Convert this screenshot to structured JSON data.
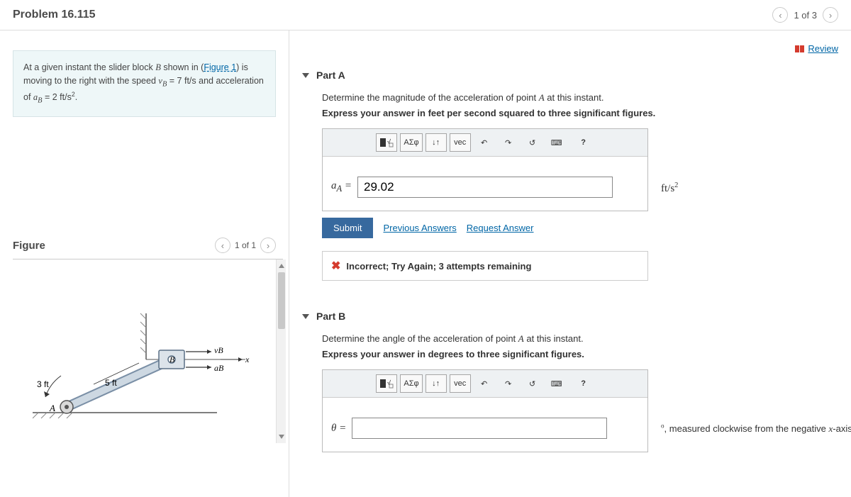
{
  "header": {
    "title": "Problem 16.115",
    "pager": "1 of 3",
    "review": "Review"
  },
  "statement": {
    "line1a": "At a given instant the slider block ",
    "line1b": " shown in (",
    "figlink": "Figure 1",
    "line1c": ") is moving to the right with the speed ",
    "vb_val": " = 7 ft/s",
    "line2a": " and acceleration of ",
    "ab_val": " = 2 ft/s",
    "period": "."
  },
  "figure": {
    "heading": "Figure",
    "pager": "1 of 1",
    "dim1": "3 ft",
    "dim2": "5 ft",
    "ptA": "A",
    "ptB": "B",
    "vB": "vB",
    "aB": "aB",
    "xlabel": "x"
  },
  "partA": {
    "title": "Part A",
    "prompt1a": "Determine the magnitude of the acceleration of point ",
    "prompt1b": " at this instant.",
    "prompt2": "Express your answer in feet per second squared to three significant figures.",
    "varlabel": "a",
    "varsub": "A",
    "eq": " = ",
    "value": "29.02",
    "unit_base": "ft/s",
    "submit": "Submit",
    "prev": "Previous Answers",
    "req": "Request Answer",
    "feedback": "Incorrect; Try Again; 3 attempts remaining"
  },
  "partB": {
    "title": "Part B",
    "prompt1a": "Determine the angle of the acceleration of point ",
    "prompt1b": " at this instant.",
    "prompt2": "Express your answer in degrees to three significant figures.",
    "varlabel": "θ",
    "eq": " = ",
    "value": "",
    "unit_trail": ", measured clockwise from the negative ",
    "unit_axis": "-axis"
  },
  "toolbar": {
    "greek": "ΑΣφ",
    "vec": "vec",
    "updown": "↓↑",
    "undo": "↶",
    "redo": "↷",
    "reset": "↺",
    "kbd": "⌨",
    "help": "?"
  }
}
